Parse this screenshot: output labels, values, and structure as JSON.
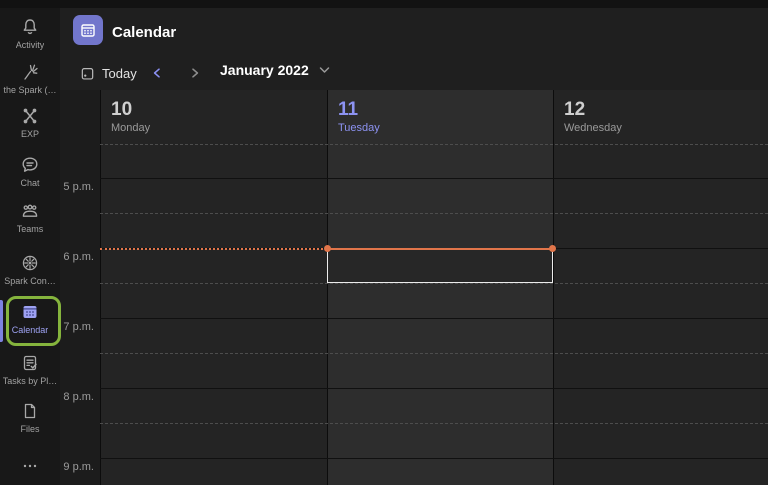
{
  "header": {
    "title": "Calendar"
  },
  "toolbar": {
    "today_label": "Today",
    "period_label": "January 2022"
  },
  "sidebar": {
    "items": [
      {
        "label": "Activity",
        "icon": "bell-icon"
      },
      {
        "label": "the Spark (…",
        "icon": "spark-icon"
      },
      {
        "label": "EXP",
        "icon": "exp-icon"
      },
      {
        "label": "Chat",
        "icon": "chat-icon"
      },
      {
        "label": "Teams",
        "icon": "teams-icon"
      },
      {
        "label": "Spark Con…",
        "icon": "spark-contacts-icon"
      },
      {
        "label": "Calendar",
        "icon": "calendar-icon",
        "active": true,
        "highlighted": true
      },
      {
        "label": "Tasks by Pl…",
        "icon": "tasks-icon"
      },
      {
        "label": "Files",
        "icon": "files-icon"
      },
      {
        "label": "",
        "icon": "more-icon"
      }
    ]
  },
  "calendar": {
    "days": [
      {
        "number": "10",
        "name": "Monday",
        "is_today": false
      },
      {
        "number": "11",
        "name": "Tuesday",
        "is_today": true
      },
      {
        "number": "12",
        "name": "Wednesday",
        "is_today": false
      }
    ],
    "times": [
      "5 p.m.",
      "6 p.m.",
      "7 p.m.",
      "8 p.m.",
      "9 p.m."
    ]
  },
  "colors": {
    "accent_purple": "#8d93f2",
    "app_icon_purple": "#7276cc",
    "current_time_orange": "#e1754a",
    "annotation_green": "#85b43d",
    "today_column_bg": "#2d2d2d",
    "column_bg": "#242424"
  }
}
